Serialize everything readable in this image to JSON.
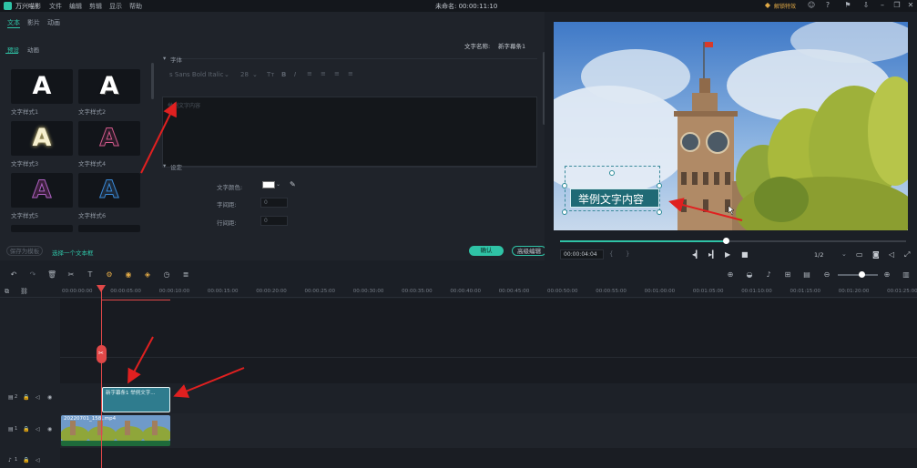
{
  "app": {
    "name": "万兴喵影",
    "menu": [
      "文件",
      "编辑",
      "剪辑",
      "显示",
      "帮助"
    ],
    "project": "未命名: 00:00:11:10",
    "unlock": "解锁特效"
  },
  "left": {
    "tabs": [
      "文本",
      "影片",
      "动画"
    ],
    "subtabs": [
      "预设",
      "动画"
    ],
    "text_name_label": "文字名称:",
    "text_name_value": "新字幕条1",
    "styles": [
      {
        "label": "文字样式1",
        "color": "#ffffff",
        "glyph": "A"
      },
      {
        "label": "文字样式2",
        "color": "#ffffff",
        "glyph": "A"
      },
      {
        "label": "文字样式3",
        "color": "#f7f0cf",
        "glyph": "A"
      },
      {
        "label": "文字样式4",
        "color": "#2b1b28",
        "glyph": "A"
      },
      {
        "label": "文字样式5",
        "color": "#3b1f3b",
        "glyph": "A"
      },
      {
        "label": "文字样式6",
        "color": "#1d2a3a",
        "glyph": "A"
      }
    ],
    "font_section": "字体",
    "font_name": "s Sans Bold Italic",
    "font_size": "28",
    "placeholder": "举例文字内容",
    "settings_section": "设定",
    "color_label": "文字颜色:",
    "spacing_label": "字间距:",
    "spacing_value": "0",
    "line_label": "行间距:",
    "line_value": "0",
    "save_template": "保存为模板",
    "choose_box": "选择一个文本框",
    "ok": "确认",
    "advanced": "高级编辑"
  },
  "preview": {
    "overlay_text": "举例文字内容"
  },
  "player": {
    "time": "00:00:04:04",
    "ratio": "1/2",
    "progress": 0.48
  },
  "timeline": {
    "ticks": [
      "00:00:00:00",
      "00:00:05:00",
      "00:00:10:00",
      "00:00:15:00",
      "00:00:20:00",
      "00:00:25:00",
      "00:00:30:00",
      "00:00:35:00",
      "00:00:40:00",
      "00:00:45:00",
      "00:00:50:00",
      "00:00:55:00",
      "00:01:00:00",
      "00:01:05:00",
      "00:01:10:00",
      "00:01:15:00",
      "00:01:20:00",
      "00:01:25:00"
    ],
    "text_clip": "新字幕条1 举例文字...",
    "video_clip": "20220701_158..mp4",
    "tracks": [
      "2",
      "1",
      "1"
    ]
  }
}
